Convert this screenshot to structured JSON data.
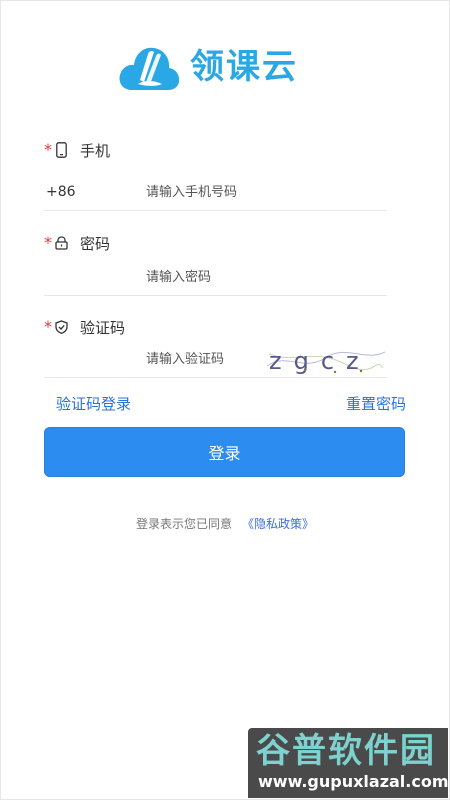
{
  "logo": {
    "text": "领课云",
    "icon": "cloud-book-logo",
    "color": "#2aa8e6"
  },
  "form": {
    "phone": {
      "label": "手机",
      "required_mark": "*",
      "icon": "phone-icon",
      "prefix": "+86",
      "placeholder": "请输入手机号码",
      "value": ""
    },
    "password": {
      "label": "密码",
      "required_mark": "*",
      "icon": "lock-icon",
      "placeholder": "请输入密码",
      "value": ""
    },
    "captcha": {
      "label": "验证码",
      "required_mark": "*",
      "icon": "shield-check-icon",
      "placeholder": "请输入验证码",
      "value": "",
      "image_text": "zgcz"
    }
  },
  "links": {
    "sms_login": "验证码登录",
    "reset_password": "重置密码"
  },
  "login_button": {
    "label": "登录",
    "color": "#2d8cf0"
  },
  "agreement": {
    "text": "登录表示您已同意",
    "policy_link": "《隐私政策》"
  },
  "watermark": {
    "title": "谷普软件园",
    "url": "www.gupuxlazal.com"
  },
  "colors": {
    "accent": "#2d8cf0",
    "link": "#2a73d6",
    "required": "#e4393c"
  }
}
